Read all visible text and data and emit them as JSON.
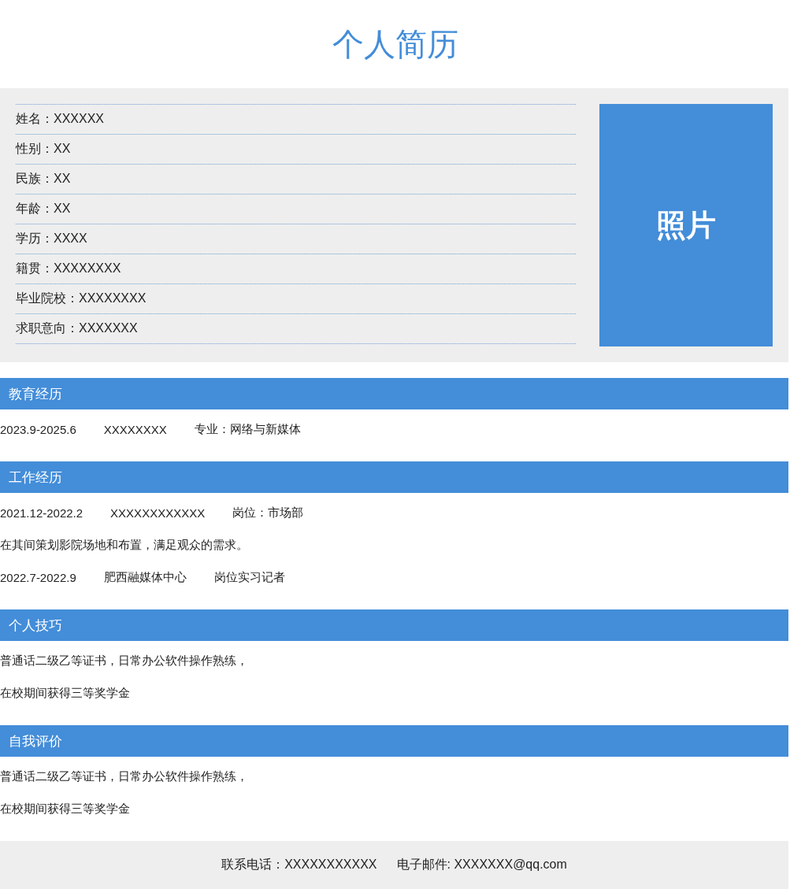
{
  "title": "个人简历",
  "info": [
    {
      "label": "姓名：",
      "value": "XXXXXX"
    },
    {
      "label": "性别：",
      "value": "XX"
    },
    {
      "label": "民族：",
      "value": "XX"
    },
    {
      "label": "年龄：",
      "value": "XX"
    },
    {
      "label": "学历：",
      "value": "XXXX"
    },
    {
      "label": "籍贯：",
      "value": "XXXXXXXX"
    },
    {
      "label": "毕业院校：",
      "value": "XXXXXXXX"
    },
    {
      "label": "求职意向：",
      "value": "XXXXXXX"
    }
  ],
  "photo": "照片",
  "sections": [
    {
      "heading": "教育经历",
      "lines": [
        [
          "2023.9-2025.6",
          "XXXXXXXX",
          "专业：网络与新媒体"
        ]
      ]
    },
    {
      "heading": "工作经历",
      "lines": [
        [
          "2021.12-2022.2",
          "XXXXXXXXXXXX",
          "岗位：市场部"
        ],
        [
          "在其间策划影院场地和布置，满足观众的需求。"
        ],
        [
          "2022.7-2022.9",
          "肥西融媒体中心",
          "岗位实习记者"
        ]
      ]
    },
    {
      "heading": "个人技巧",
      "lines": [
        [
          "普通话二级乙等证书，日常办公软件操作熟练，"
        ],
        [
          "在校期间获得三等奖学金"
        ]
      ]
    },
    {
      "heading": "自我评价",
      "lines": [
        [
          "普通话二级乙等证书，日常办公软件操作熟练，"
        ],
        [
          "在校期间获得三等奖学金"
        ]
      ]
    }
  ],
  "footer": [
    "联系电话：XXXXXXXXXXX",
    "电子邮件: XXXXXXX@qq.com"
  ]
}
